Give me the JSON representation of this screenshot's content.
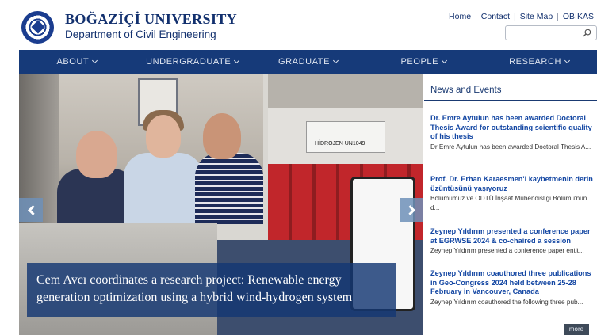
{
  "header": {
    "university": "BOĞAZİÇİ UNIVERSITY",
    "department": "Department of Civil Engineering",
    "top_links": [
      "Home",
      "Contact",
      "Site Map",
      "OBIKAS"
    ],
    "search": {
      "placeholder": ""
    }
  },
  "nav": {
    "items": [
      "ABOUT",
      "UNDERGRADUATE",
      "GRADUATE",
      "PEOPLE",
      "RESEARCH"
    ]
  },
  "slider": {
    "caption": "Cem Avcı coordinates a research project: Renewable energy generation optimization using a hybrid wind-hydrogen system",
    "sign_text": "HİDROJEN UN1049"
  },
  "news": {
    "title": "News and Events",
    "items": [
      {
        "title": "Dr. Emre Aytulun has been awarded Doctoral Thesis Award for outstanding scientific quality of his thesis",
        "summary": "Dr Emre Aytulun has been awarded Doctoral Thesis A..."
      },
      {
        "title": "Prof. Dr. Erhan Karaesmen'i kaybetmenin derin üzüntüsünü yaşıyoruz",
        "summary": "Bölümümüz ve ODTÜ İnşaat Mühendisliği Bölümü'nün d..."
      },
      {
        "title": "Zeynep Yıldırım presented a conference paper at EGRWSE 2024 & co-chaired a session",
        "summary": "Zeynep Yıldırım presented a conference paper entit..."
      },
      {
        "title": "Zeynep Yıldırım coauthored three publications in Geo-Congress 2024 held between 25-28 February in Vancouver, Canada",
        "summary": "Zeynep Yıldırım coauthored the following three pub..."
      }
    ],
    "more_label": "more"
  },
  "colors": {
    "brand_navy": "#163a79",
    "link_blue": "#1447a3",
    "caption_bg": "#143773"
  },
  "icons": [
    "university-seal-icon",
    "search-icon",
    "chevron-down-icon",
    "arrow-left-icon",
    "arrow-right-icon"
  ]
}
